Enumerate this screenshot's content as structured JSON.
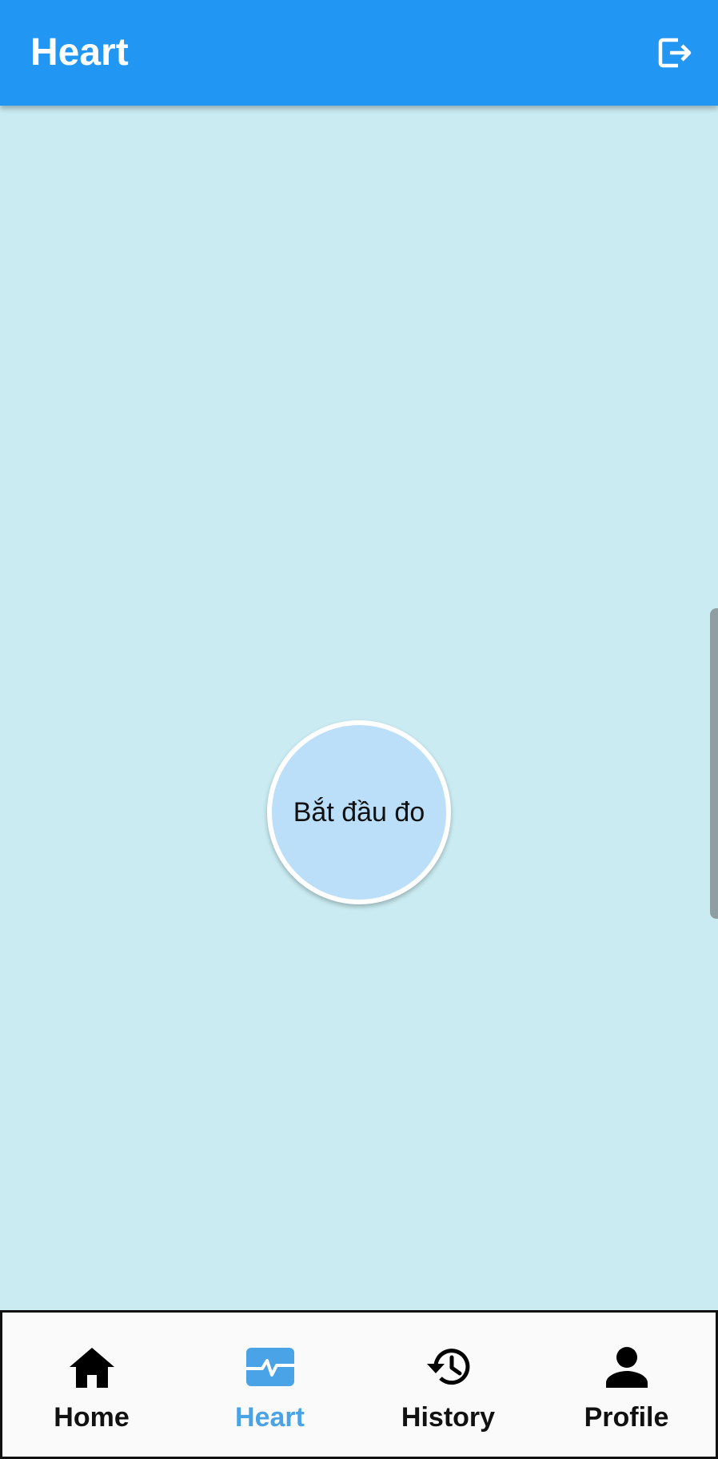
{
  "app_bar": {
    "title": "Heart",
    "logout_icon": "logout-icon"
  },
  "main": {
    "measure_button_label": "Bắt đầu đo"
  },
  "bottom_nav": {
    "active_color": "#4aa3e6",
    "items": [
      {
        "label": "Home",
        "icon": "home-icon",
        "active": false
      },
      {
        "label": "Heart",
        "icon": "heart-monitor-icon",
        "active": true
      },
      {
        "label": "History",
        "icon": "history-icon",
        "active": false
      },
      {
        "label": "Profile",
        "icon": "person-icon",
        "active": false
      }
    ]
  },
  "colors": {
    "app_bar": "#2196f3",
    "background": "#c9ebf1",
    "measure_button": "#bcdff9"
  }
}
